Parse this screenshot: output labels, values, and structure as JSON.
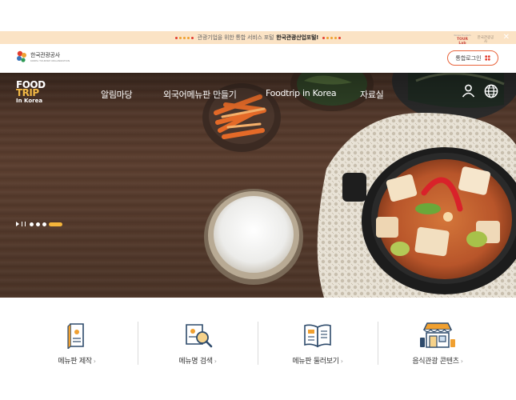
{
  "notice": {
    "text": "관광기업을 위한 통합 서비스 포털",
    "highlight": "한국관광산업포털!",
    "partner1_line1": "Korea Tourism",
    "partner1_line2": "TOUR Lab",
    "partner2": "한국관광공사",
    "close_icon": "close-icon",
    "dot_colors": [
      "#e23c2e",
      "#f0a030",
      "#f0a030",
      "#f0a030",
      "#e23c2e"
    ]
  },
  "header": {
    "org_name": "한국관광공사",
    "org_name_en": "KOREA TOURISM ORGANIZATION",
    "login_label": "통합로그인",
    "accent": "#e8633a"
  },
  "site": {
    "logo_line1": "FOOD",
    "logo_line2": "TRIP",
    "logo_line3": "In Korea"
  },
  "nav": {
    "items": [
      {
        "label": "알림마당"
      },
      {
        "label": "외국어메뉴판 만들기"
      },
      {
        "label": "Foodtrip in Korea"
      },
      {
        "label": "자료실"
      }
    ],
    "user_icon": "user-icon",
    "language_icon": "globe-icon"
  },
  "slider": {
    "controls": [
      "play-icon",
      "pause-icon"
    ],
    "slide_count": 4,
    "active_index": 3,
    "accent": "#f5b53a"
  },
  "quick_menu": {
    "items": [
      {
        "label": "메뉴판 제작",
        "icon": "menu-book-icon"
      },
      {
        "label": "메뉴명 검색",
        "icon": "menu-search-icon"
      },
      {
        "label": "메뉴판 둘러보기",
        "icon": "open-menu-icon"
      },
      {
        "label": "음식관광 콘텐츠",
        "icon": "restaurant-shop-icon"
      }
    ],
    "arrow": "›",
    "icon_accent": "#f0a030",
    "icon_stroke": "#2d4a6b"
  }
}
